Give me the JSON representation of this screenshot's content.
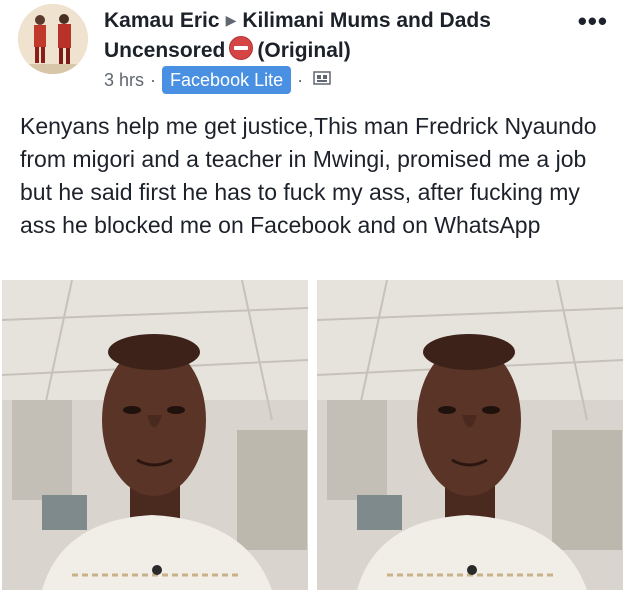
{
  "post": {
    "author": "Kamau Eric",
    "group_line1": "Kilimani Mums and Dads",
    "group_line2_prefix": "Uncensored",
    "group_line2_suffix": "(Original)",
    "time": "3 hrs",
    "app_badge": "Facebook Lite",
    "menu": "...",
    "text": "Kenyans help me get justice,This man Fredrick Nyaundo from migori and a teacher in Mwingi, promised me a job but he said first he has to fuck my ass, after fucking my ass he blocked me on Facebook and on WhatsApp"
  },
  "icons": {
    "header_arrow": "triangle-right-icon",
    "group_emoji": "no-entry-icon",
    "audience": "album-icon",
    "menu": "more-options-icon"
  },
  "colors": {
    "badge": "#4a90e2",
    "emoji": "#d64545"
  }
}
